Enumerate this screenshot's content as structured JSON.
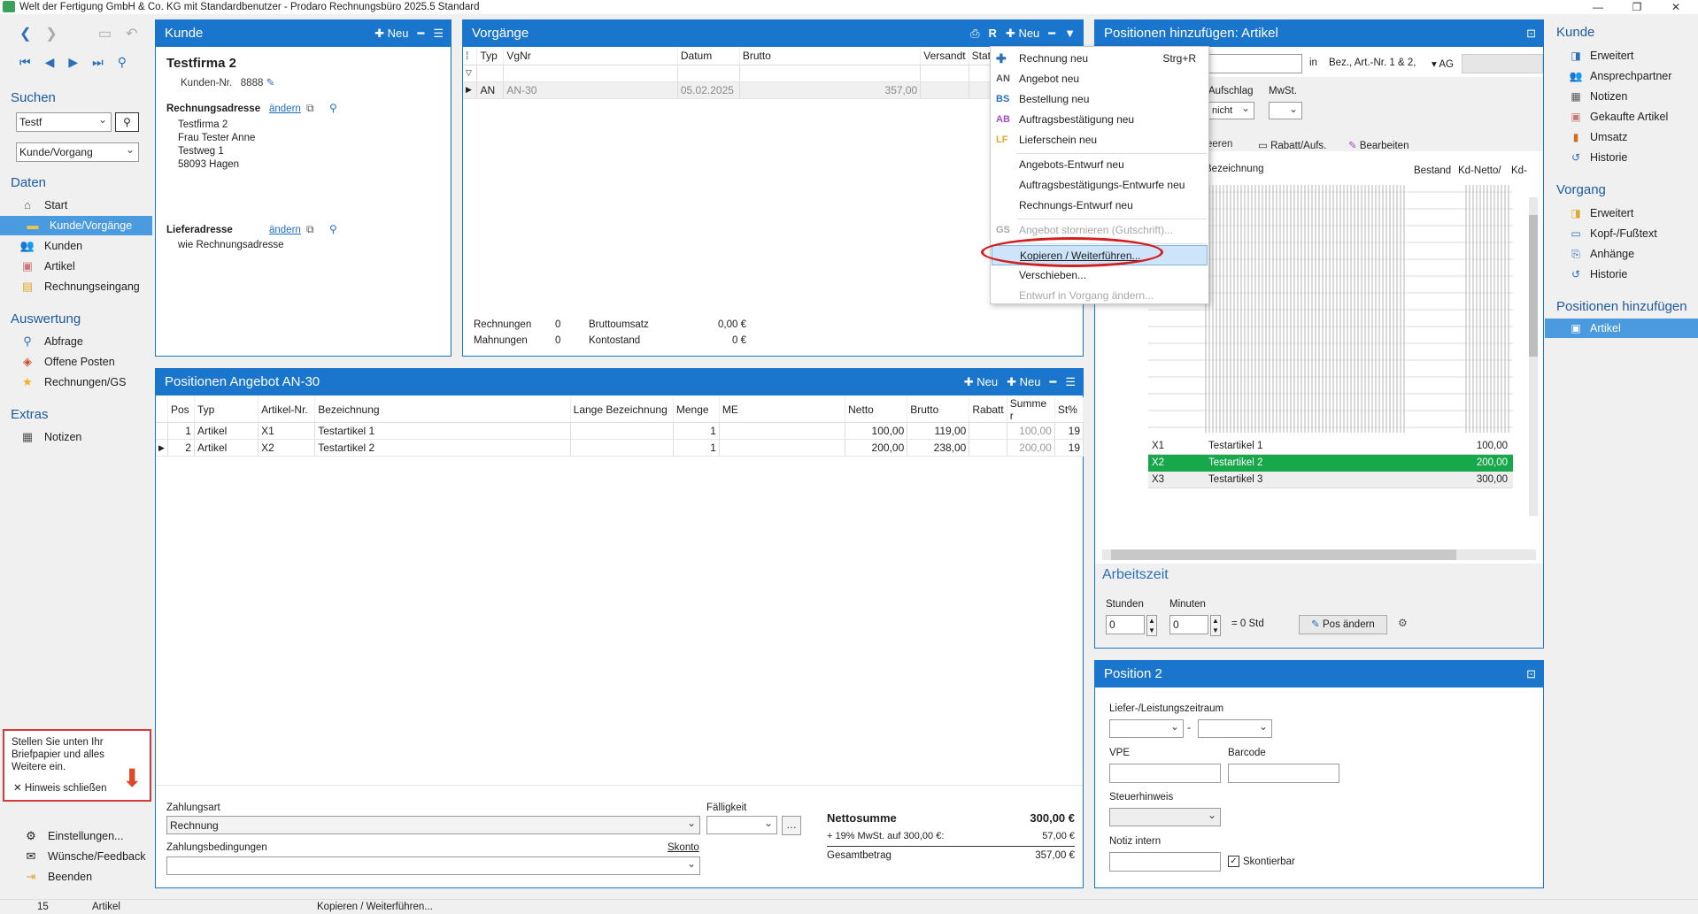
{
  "window": {
    "title": "Welt der Fertigung GmbH & Co. KG mit Standardbenutzer  -  Prodaro Rechnungsbüro 2025.5 Standard"
  },
  "sidebar": {
    "search_heading": "Suchen",
    "search_value": "Testf",
    "search_mode": "Kunde/Vorgang",
    "daten_heading": "Daten",
    "daten": [
      {
        "label": "Start",
        "icon": "home-icon"
      },
      {
        "label": "Kunde/Vorgänge",
        "icon": "folder-icon"
      },
      {
        "label": "Kunden",
        "icon": "people-icon"
      },
      {
        "label": "Artikel",
        "icon": "article-icon"
      },
      {
        "label": "Rechnungseingang",
        "icon": "inbox-icon"
      }
    ],
    "auswertung_heading": "Auswertung",
    "auswertung": [
      {
        "label": "Abfrage",
        "icon": "search-icon"
      },
      {
        "label": "Offene Posten",
        "icon": "open-items-icon"
      },
      {
        "label": "Rechnungen/GS",
        "icon": "star-icon"
      }
    ],
    "extras_heading": "Extras",
    "extras": [
      {
        "label": "Notizen",
        "icon": "notes-icon"
      }
    ],
    "hint_text": "Stellen Sie unten Ihr Briefpapier und alles Weitere ein.",
    "hint_close": "Hinweis schließen",
    "bottom": [
      {
        "label": "Einstellungen...",
        "icon": "settings-icon"
      },
      {
        "label": "Wünsche/Feedback",
        "icon": "feedback-icon"
      },
      {
        "label": "Beenden",
        "icon": "exit-icon"
      }
    ]
  },
  "kunde": {
    "title": "Kunde",
    "neu": "Neu",
    "name": "Testfirma 2",
    "kunden_nr_label": "Kunden-Nr.",
    "kunden_nr": "8888",
    "rechnungsadresse_label": "Rechnungsadresse",
    "aendern": "ändern",
    "address_lines": [
      "Testfirma 2",
      "Frau Tester Anne",
      "Testweg 1",
      "58093 Hagen"
    ],
    "lieferadresse_label": "Lieferadresse",
    "liefer_text": "wie Rechnungsadresse"
  },
  "vorgaenge": {
    "title": "Vorgänge",
    "neu": "Neu",
    "columns": [
      "Typ",
      "VgNr",
      "Datum",
      "Brutto",
      "Versandt",
      "Stat"
    ],
    "rows": [
      {
        "typ": "AN",
        "vgnr": "AN-30",
        "datum": "05.02.2025",
        "brutto": "357,00"
      }
    ],
    "summary": {
      "rechnungen_label": "Rechnungen",
      "rechnungen": "0",
      "mahnungen_label": "Mahnungen",
      "mahnungen": "0",
      "bruttoumsatz_label": "Bruttoumsatz",
      "bruttoumsatz": "0,00 €",
      "kontostand_label": "Kontostand",
      "kontostand": "0 €"
    }
  },
  "menu": {
    "items": [
      {
        "prefix": "",
        "label": "Rechnung neu",
        "shortcut": "Strg+R",
        "disabled": false
      },
      {
        "prefix": "AN",
        "label": "Angebot neu",
        "shortcut": "",
        "disabled": false
      },
      {
        "prefix": "BS",
        "label": "Bestellung neu",
        "shortcut": "",
        "disabled": false
      },
      {
        "prefix": "AB",
        "label": "Auftragsbestätigung neu",
        "shortcut": "",
        "disabled": false
      },
      {
        "prefix": "LF",
        "label": "Lieferschein neu",
        "shortcut": "",
        "disabled": false
      },
      {
        "prefix": "",
        "label": "Angebots-Entwurf neu",
        "shortcut": "",
        "disabled": false
      },
      {
        "prefix": "",
        "label": "Auftragsbestätigungs-Entwurfe neu",
        "shortcut": "",
        "disabled": false
      },
      {
        "prefix": "",
        "label": "Rechnungs-Entwurf neu",
        "shortcut": "",
        "disabled": false
      },
      {
        "prefix": "GS",
        "label": "Angebot stornieren (Gutschrift)...",
        "shortcut": "",
        "disabled": true
      },
      {
        "prefix": "",
        "label": "Kopieren / Weiterführen...",
        "shortcut": "",
        "disabled": false,
        "highlighted": true
      },
      {
        "prefix": "",
        "label": "Verschieben...",
        "shortcut": "",
        "disabled": false
      },
      {
        "prefix": "",
        "label": "Entwurf in Vorgang ändern...",
        "shortcut": "",
        "disabled": true
      }
    ]
  },
  "positionen": {
    "title": "Positionen Angebot AN-30",
    "neu": "Neu",
    "columns": [
      "Pos",
      "Typ",
      "Artikel-Nr.",
      "Bezeichnung",
      "Lange Bezeichnung",
      "Menge",
      "ME",
      "Netto",
      "Brutto",
      "Rabatt",
      "Summe r",
      "St%"
    ],
    "rows": [
      {
        "pos": "1",
        "typ": "Artikel",
        "nr": "X1",
        "bez": "Testartikel 1",
        "menge": "1",
        "netto": "100,00",
        "brutto": "119,00",
        "summe": "100,00",
        "st": "19"
      },
      {
        "pos": "2",
        "typ": "Artikel",
        "nr": "X2",
        "bez": "Testartikel 2",
        "menge": "1",
        "netto": "200,00",
        "brutto": "238,00",
        "summe": "200,00",
        "st": "19"
      }
    ],
    "zahlungsart_label": "Zahlungsart",
    "zahlungsart": "Rechnung",
    "faelligkeit_label": "Fälligkeit",
    "zahlungsbed_label": "Zahlungsbedingungen",
    "skonto": "Skonto",
    "nettosumme_label": "Nettosumme",
    "nettosumme": "300,00 €",
    "mwst_label": "+ 19% MwSt. auf 300,00 €:",
    "mwst": "57,00 €",
    "gesamt_label": "Gesamtbetrag",
    "gesamt": "357,00 €"
  },
  "artikel": {
    "title": "Positionen hinzufügen: Artikel",
    "in_label": "in",
    "in_value": "Bez., Art.-Nr. 1 & 2,",
    "ag": "AG",
    "aufschlag_label": "Aufschlag",
    "aufschlag": "nicht",
    "mwst_label": "MwSt.",
    "leeren": "eeren",
    "rabatt": "Rabatt/Aufs.",
    "bearbeiten": "Bearbeiten",
    "columns": [
      "Bezeichnung",
      "Bestand",
      "Kd-Netto/",
      "Kd-"
    ],
    "rows": [
      {
        "nr": "X1",
        "bez": "Testartikel 1",
        "preis": "100,00"
      },
      {
        "nr": "X2",
        "bez": "Testartikel 2",
        "preis": "200,00",
        "selected": true
      },
      {
        "nr": "X3",
        "bez": "Testartikel 3",
        "preis": "300,00"
      }
    ],
    "arbeitszeit": "Arbeitszeit",
    "stunden_label": "Stunden",
    "minuten_label": "Minuten",
    "stunden": "0",
    "minuten": "0",
    "std_text": "= 0 Std",
    "pos_aendern": "Pos ändern"
  },
  "position2": {
    "title": "Position 2",
    "liefer_label": "Liefer-/Leistungszeitraum",
    "vpe_label": "VPE",
    "barcode_label": "Barcode",
    "steuer_label": "Steuerhinweis",
    "notiz_label": "Notiz intern",
    "skontierbar": "Skontierbar"
  },
  "rightpanel": {
    "kunde_heading": "Kunde",
    "kunde": [
      "Erweitert",
      "Ansprechpartner",
      "Notizen",
      "Gekaufte Artikel",
      "Umsatz",
      "Historie"
    ],
    "vorgang_heading": "Vorgang",
    "vorgang": [
      "Erweitert",
      "Kopf-/Fußtext",
      "Anhänge",
      "Historie"
    ],
    "pos_heading": "Positionen hinzufügen",
    "pos": [
      "Artikel"
    ]
  },
  "status": {
    "count": "15",
    "context": "Artikel",
    "action": "Kopieren / Weiterführen..."
  }
}
